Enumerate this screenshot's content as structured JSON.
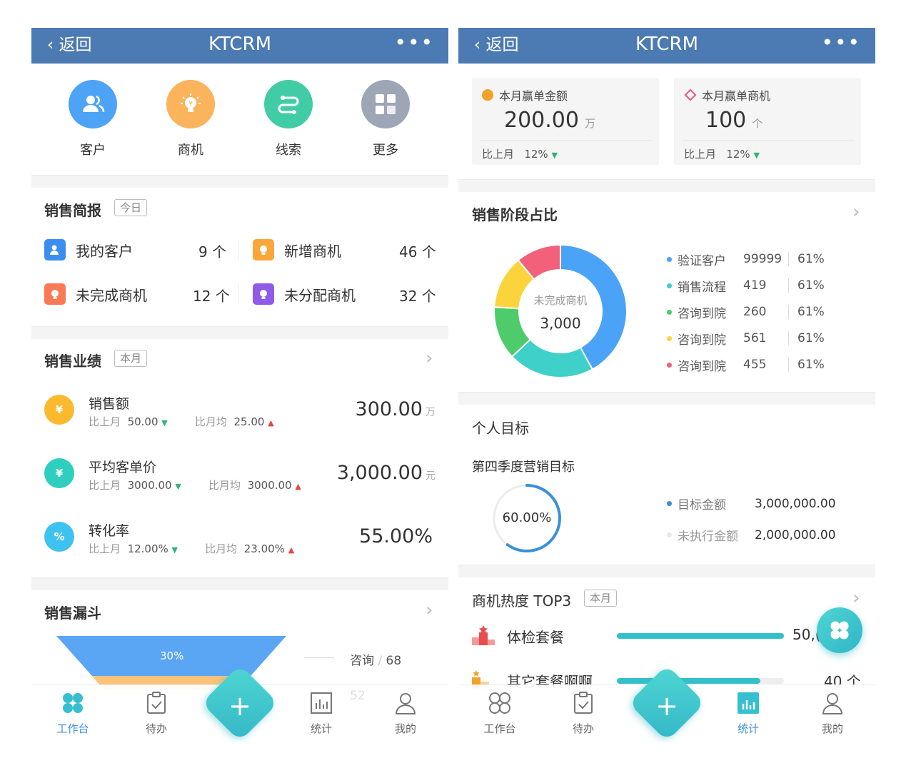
{
  "left": {
    "nav": {
      "back": "返回",
      "title": "KTCRM",
      "more": "•••"
    },
    "quick": [
      {
        "label": "客户",
        "icon": "user-icon",
        "color": "#4da3f5"
      },
      {
        "label": "商机",
        "icon": "lightbulb-icon",
        "color": "#fbb35c"
      },
      {
        "label": "线索",
        "icon": "route-icon",
        "color": "#42cca5"
      },
      {
        "label": "更多",
        "icon": "grid-icon",
        "color": "#9ea6b6"
      }
    ],
    "brief": {
      "title": "销售简报",
      "tag": "今日",
      "items": [
        {
          "label": "我的客户",
          "value": "9 个",
          "icon": "user-icon",
          "color": "#3b8ef0"
        },
        {
          "label": "新增商机",
          "value": "46 个",
          "icon": "lightbulb-icon",
          "color": "#f9a63b"
        },
        {
          "label": "未完成商机",
          "value": "12 个",
          "icon": "lightbulb-icon",
          "color": "#fa7a55"
        },
        {
          "label": "未分配商机",
          "value": "32 个",
          "icon": "lightbulb-icon",
          "color": "#8f5be8"
        }
      ]
    },
    "perf": {
      "title": "销售业绩",
      "tag": "本月",
      "items": [
        {
          "name": "销售额",
          "mom_label": "比上月",
          "mom": "50.00",
          "avg_label": "比月均",
          "avg": "25.00",
          "value": "300.00",
          "unit": "万",
          "icon": "money-icon",
          "color": "#fbb92e"
        },
        {
          "name": "平均客单价",
          "mom_label": "比上月",
          "mom": "3000.00",
          "avg_label": "比月均",
          "avg": "3000.00",
          "value": "3,000.00",
          "unit": "元",
          "icon": "yen-icon",
          "color": "#2fcfc0"
        },
        {
          "name": "转化率",
          "mom_label": "比上月",
          "mom": "12.00%",
          "avg_label": "比月均",
          "avg": "23.00%",
          "value": "55.00%",
          "unit": "",
          "icon": "percent-icon",
          "color": "#3ec2f0"
        }
      ]
    },
    "funnel": {
      "title": "销售漏斗",
      "top_pct": "30%",
      "top_label": "咨询",
      "top_value": "68",
      "second_value": "52"
    },
    "tabs": [
      "工作台",
      "待办",
      "统计",
      "我的"
    ]
  },
  "right": {
    "nav": {
      "back": "返回",
      "title": "KTCRM",
      "more": "•••"
    },
    "cards": [
      {
        "title": "本月赢单金额",
        "value": "200.00",
        "unit": "万",
        "cmp_label": "比上月",
        "cmp": "12%",
        "icon": "money-bag-icon",
        "color": "#f4a12b"
      },
      {
        "title": "本月赢单商机",
        "value": "100",
        "unit": "个",
        "cmp_label": "比上月",
        "cmp": "12%",
        "icon": "diamond-icon",
        "color": "#f0508a"
      }
    ],
    "stage": {
      "title": "销售阶段占比",
      "center_label": "未完成商机",
      "center_value": "3,000",
      "chart_data": {
        "type": "pie",
        "series": [
          {
            "name": "验证客户",
            "value": 99999,
            "pct": "61%",
            "color": "#4aa3f7"
          },
          {
            "name": "销售流程",
            "value": 419,
            "pct": "61%",
            "color": "#3ed0c9"
          },
          {
            "name": "咨询到院",
            "value": 260,
            "pct": "61%",
            "color": "#4ecb6b"
          },
          {
            "name": "咨询到院",
            "value": 561,
            "pct": "61%",
            "color": "#fbd43b"
          },
          {
            "name": "咨询到院",
            "value": 455,
            "pct": "61%",
            "color": "#f2607a"
          }
        ],
        "ring_shares": [
          0.42,
          0.21,
          0.13,
          0.13,
          0.11
        ]
      }
    },
    "goal": {
      "title": "个人目标",
      "subtitle": "第四季度营销目标",
      "progress": 0.6,
      "progress_text": "60.00%",
      "target_label": "目标金额",
      "target_value": "3,000,000.00",
      "remaining_label": "未执行金额",
      "remaining_value": "2,000,000.00"
    },
    "hot": {
      "title": "商机热度 TOP3",
      "tag": "本月",
      "items": [
        {
          "name": "体检套餐",
          "value": "50,(",
          "fill": 1.0
        },
        {
          "name": "其它套餐啊啊",
          "value": "40 个",
          "fill": 0.86
        }
      ]
    },
    "tabs": [
      "工作台",
      "待办",
      "统计",
      "我的"
    ]
  }
}
